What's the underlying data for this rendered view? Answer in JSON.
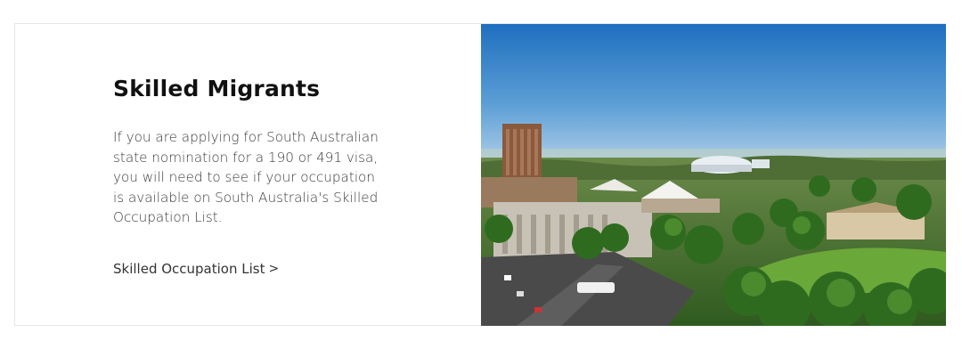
{
  "card": {
    "title": "Skilled Migrants",
    "description": "If you are applying for South Australian state nomination for a 190 or 491 visa, you will need to see if your occupation is available on South Australia's Skilled Occupation List.",
    "link_label": "Skilled Occupation List",
    "link_chevron": ">"
  },
  "colors": {
    "title": "#111111",
    "body_text": "#3b3b3b",
    "border": "#e6e6e6",
    "sky_top": "#1f6fbf",
    "foliage": "#3f7d2a"
  },
  "image": {
    "subject": "Aerial view of Adelaide city with parklands and oval"
  }
}
